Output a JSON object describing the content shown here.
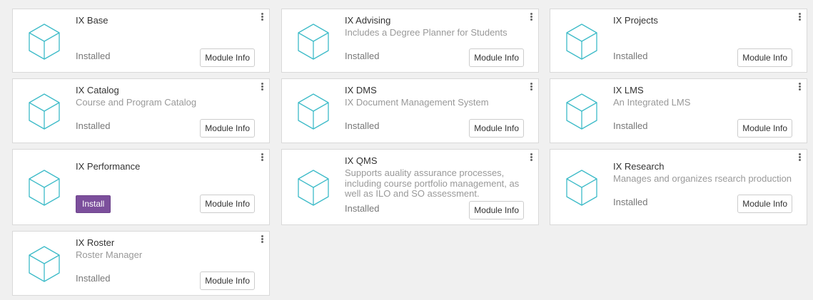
{
  "colors": {
    "cube_stroke": "#3dbbc8",
    "install_button": "#7c4f9c",
    "card_border": "#d9d9d9",
    "background": "#f0f0f0"
  },
  "card_menu_icon": "kebab-vertical-icon",
  "module_icon": "cube-icon",
  "modules": [
    {
      "title": "IX Base",
      "summary": "",
      "status": "Installed",
      "info_label": "Module Info"
    },
    {
      "title": "IX Advising",
      "summary": "Includes a Degree Planner for Students",
      "status": "Installed",
      "info_label": "Module Info"
    },
    {
      "title": "IX Projects",
      "summary": "",
      "status": "Installed",
      "info_label": "Module Info"
    },
    {
      "title": "IX Catalog",
      "summary": "Course and Program Catalog",
      "status": "Installed",
      "info_label": "Module Info"
    },
    {
      "title": "IX DMS",
      "summary": "IX Document Management System",
      "status": "Installed",
      "info_label": "Module Info"
    },
    {
      "title": "IX LMS",
      "summary": "An Integrated LMS",
      "status": "Installed",
      "info_label": "Module Info"
    },
    {
      "title": "IX Performance",
      "summary": "",
      "install_label": "Install",
      "info_label": "Module Info"
    },
    {
      "title": "IX QMS",
      "summary": "Supports auality assurance processes, including course portfolio management, as well as ILO and SO assessment.",
      "status": "Installed",
      "info_label": "Module Info"
    },
    {
      "title": "IX Research",
      "summary": "Manages and organizes rsearch production",
      "status": "Installed",
      "info_label": "Module Info"
    },
    {
      "title": "IX Roster",
      "summary": "Roster Manager",
      "status": "Installed",
      "info_label": "Module Info"
    }
  ]
}
